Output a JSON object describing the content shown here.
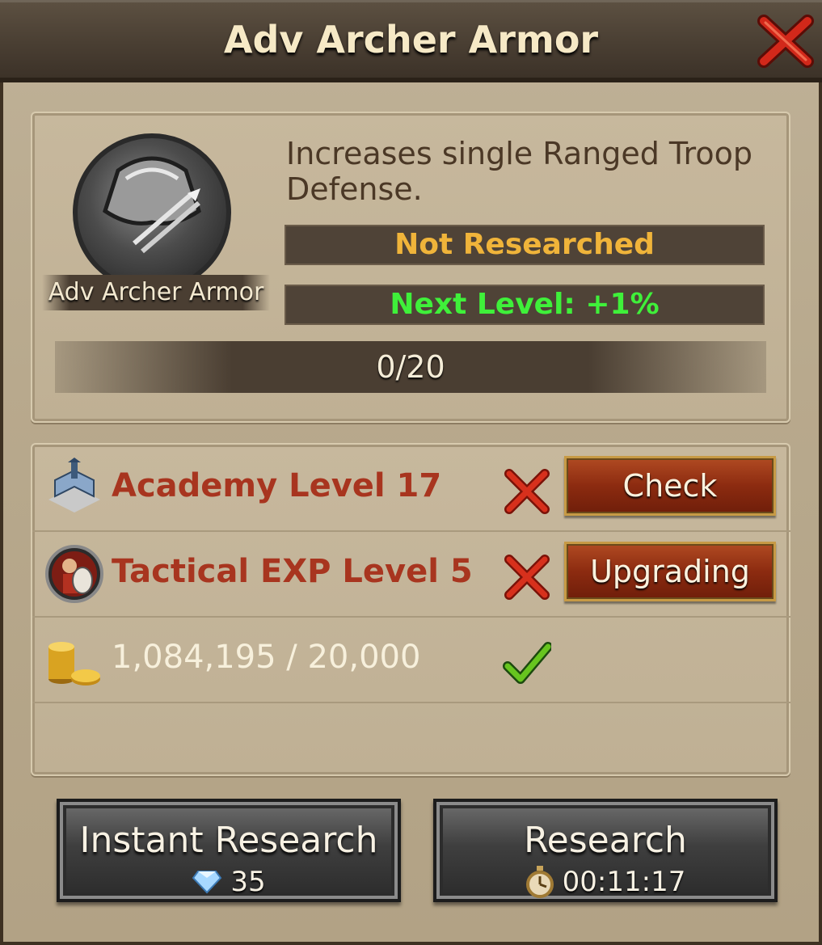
{
  "header": {
    "title": "Adv Archer Armor"
  },
  "research": {
    "icon_name": "Adv Archer Armor",
    "description": "Increases single Ranged Troop Defense.",
    "status": "Not Researched",
    "next_level": "Next Level: +1%",
    "progress_text": "0/20",
    "level_current": 0,
    "level_max": 20
  },
  "requirements": [
    {
      "icon": "academy-building-icon",
      "label": "Academy Level 17",
      "met": false,
      "button": "Check"
    },
    {
      "icon": "tactical-exp-icon",
      "label": "Tactical EXP Level 5",
      "met": false,
      "button": "Upgrading"
    },
    {
      "icon": "gold-coins-icon",
      "label": "1,084,195 / 20,000",
      "met": true
    }
  ],
  "actions": {
    "instant": {
      "label": "Instant Research",
      "cost": "35",
      "cost_icon": "diamond-icon"
    },
    "research": {
      "label": "Research",
      "time": "00:11:17",
      "time_icon": "stopwatch-icon"
    }
  },
  "colors": {
    "status_orange": "#f0b43a",
    "next_level_green": "#3ff03a",
    "requirement_red": "#a8351f",
    "requirement_met": "#f7f0dc"
  }
}
